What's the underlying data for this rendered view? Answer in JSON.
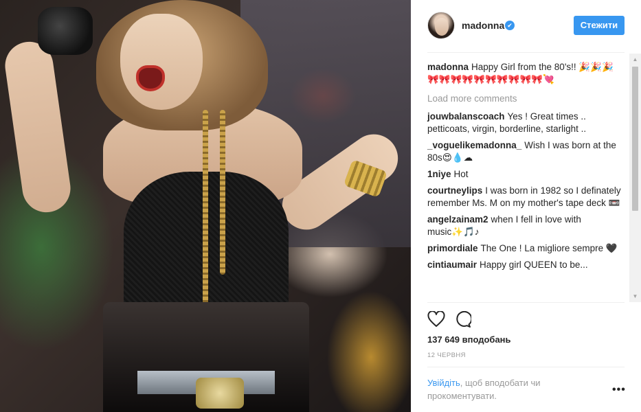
{
  "post": {
    "image_alt": "photo"
  },
  "header": {
    "username": "madonna",
    "verified_mark": "✔",
    "follow_label": "Стежити"
  },
  "caption": {
    "user": "madonna",
    "text": "Happy Girl from the 80's!! 🎉🎉🎉 🎀🎀🎀🎀🎀🎀🎀🎀🎀🎀💘"
  },
  "load_more": "Load more comments",
  "comments": [
    {
      "user": "jouwbalanscoach",
      "text": "Yes ! Great times .. petticoats, virgin, borderline, starlight .."
    },
    {
      "user": "_voguelikemadonna_",
      "text": "Wish I was born at the 80s😍💧☁"
    },
    {
      "user": "1niye",
      "text": "Hot"
    },
    {
      "user": "courtneylips",
      "text": "I was born in 1982 so I definately remember Ms. M on my mother's tape deck 📼"
    },
    {
      "user": "angelzainam2",
      "text": "when I fell in love with music✨🎵♪"
    },
    {
      "user": "primordiale",
      "text": "The One ! La migliore sempre 🖤"
    },
    {
      "user": "cintiaumair",
      "text": "Happy girl QUEEN to be..."
    }
  ],
  "scrollbar": {
    "up": "▲",
    "down": "▼"
  },
  "likes": "137 649 вподобань",
  "date": "12 ЧЕРВНЯ",
  "login": {
    "link": "Увійдіть",
    "rest": ", щоб вподобати чи прокоментувати."
  },
  "more_label": "•••",
  "colors": {
    "accent": "#3897f0",
    "text": "#262626",
    "muted": "#999999"
  },
  "icons": [
    "verified-badge-icon",
    "heart-icon",
    "comment-icon",
    "more-options-icon"
  ]
}
